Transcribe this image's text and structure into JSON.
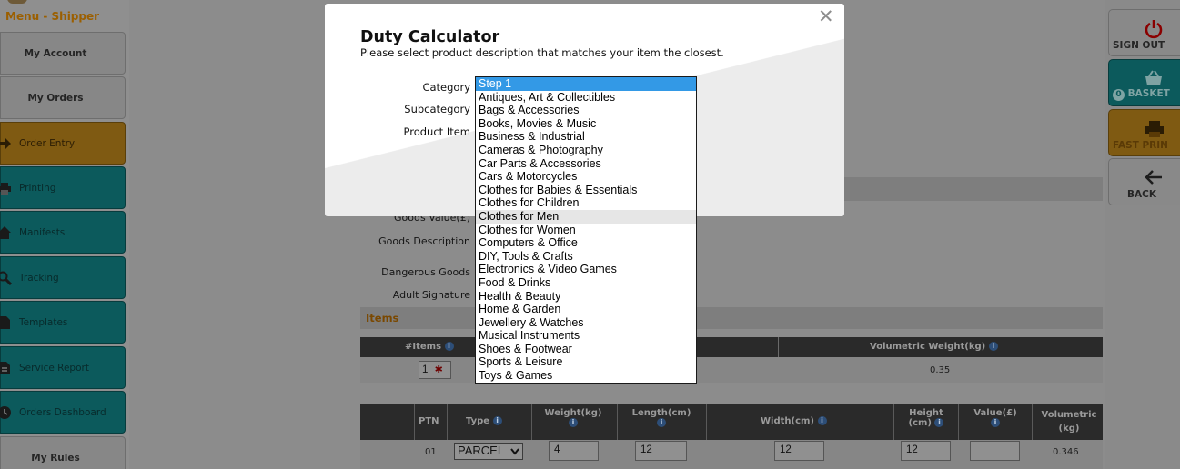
{
  "sidebar": {
    "title": "Menu - Shipper",
    "items": [
      {
        "label": "My Account",
        "style": "gray",
        "icon": ""
      },
      {
        "label": "My Orders",
        "style": "gray",
        "icon": ""
      },
      {
        "label": "Order Entry",
        "style": "orange",
        "icon": "arrow-right-icon"
      },
      {
        "label": "Printing",
        "style": "teal",
        "icon": "printer-icon"
      },
      {
        "label": "Manifests",
        "style": "teal",
        "icon": "home-icon"
      },
      {
        "label": "Tracking",
        "style": "teal",
        "icon": "magnifier-icon"
      },
      {
        "label": "Templates",
        "style": "teal",
        "icon": "document-icon"
      },
      {
        "label": "Service Report",
        "style": "teal",
        "icon": "report-icon"
      },
      {
        "label": "Orders Dashboard",
        "style": "teal",
        "icon": "clock-icon"
      },
      {
        "label": "My Rules",
        "style": "gray",
        "icon": ""
      }
    ]
  },
  "right_buttons": [
    {
      "label": "SIGN OUT",
      "style": "gray",
      "icon": "power-icon"
    },
    {
      "label": "BASKET",
      "badge": "0",
      "style": "teal",
      "icon": "basket-icon"
    },
    {
      "label": "FAST PRIN",
      "style": "orange",
      "icon": "printer-icon"
    },
    {
      "label": "BACK",
      "style": "gray",
      "icon": "arrow-left-icon"
    }
  ],
  "background_form": {
    "goods_value_label": "Goods Value(£)",
    "goods_description_label": "Goods Description",
    "dangerous_goods_label": "Dangerous Goods",
    "adult_signature_label": "Adult Signature",
    "items_heading": "Items",
    "items_table": {
      "col_items": "#Items",
      "col_volumetric_weight": "Volumetric Weight(kg)",
      "items_count": "1",
      "volumetric_weight_value": "0.35"
    },
    "parcel_table": {
      "headers": {
        "ptn": "PTN",
        "type": "Type",
        "weight": "Weight(kg)",
        "length": "Length(cm)",
        "width": "Width(cm)",
        "height_line1": "Height",
        "height_line2": "(cm)",
        "value": "Value(£)",
        "volumetric_line1": "Volumetric",
        "volumetric_line2": "(kg)"
      },
      "row": {
        "ptn": "01",
        "type": "PARCEL",
        "weight": "4",
        "length": "12",
        "width": "12",
        "height": "12",
        "value": "",
        "volumetric": "0.346"
      }
    }
  },
  "modal": {
    "title": "Duty Calculator",
    "subtitle": "Please select product description that matches your item the closest.",
    "labels": {
      "category": "Category",
      "subcategory": "Subcategory",
      "product_item": "Product Item"
    },
    "close_icon": "close-icon",
    "category_options": [
      "Step 1",
      "Antiques, Art & Collectibles",
      "Bags & Accessories",
      "Books, Movies & Music",
      "Business & Industrial",
      "Cameras & Photography",
      "Car Parts & Accessories",
      "Cars & Motorcycles",
      "Clothes for Babies & Essentials",
      "Clothes for Children",
      "Clothes for Men",
      "Clothes for Women",
      "Computers & Office",
      "DIY, Tools & Crafts",
      "Electronics & Video Games",
      "Food & Drinks",
      "Health & Beauty",
      "Home & Garden",
      "Jewellery & Watches",
      "Musical Instruments",
      "Shoes & Footwear",
      "Sports & Leisure",
      "Toys & Games"
    ],
    "selected_index": 0,
    "hover_index": 10
  },
  "colors": {
    "overlay": "#8c8c8c",
    "selected_option": "#3399e6",
    "hover_option": "#e6e6e6",
    "items_heading": "#7a4800"
  }
}
